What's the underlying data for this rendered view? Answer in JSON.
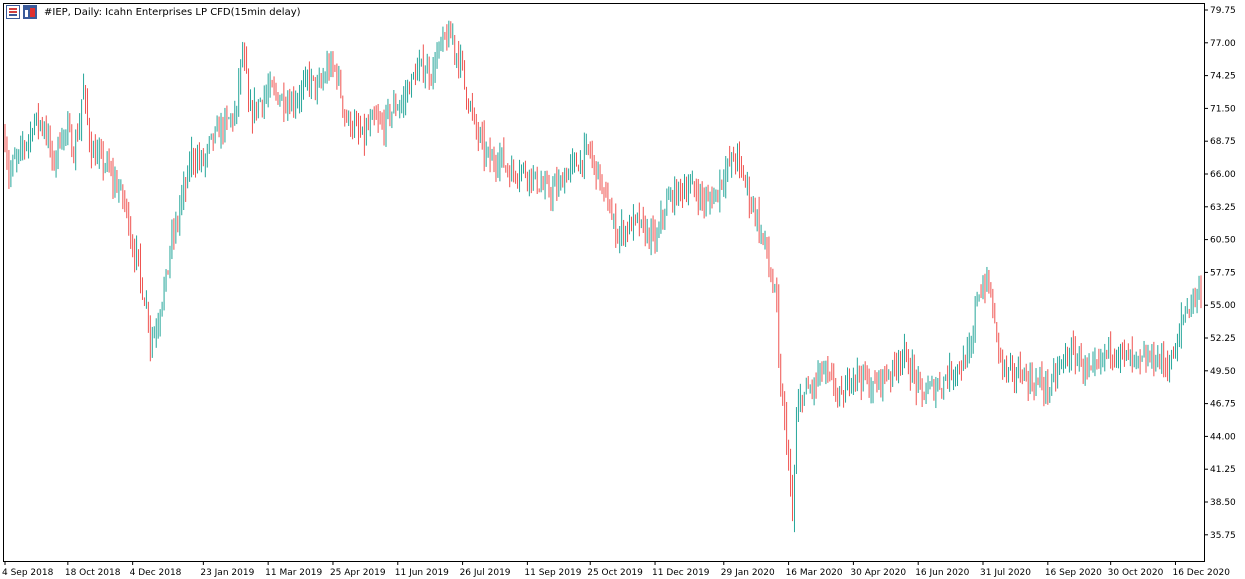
{
  "header": {
    "title": "#IEP, Daily:  Icahn Enterprises LP CFD(15min delay)",
    "icons": [
      "chart-settings-icon",
      "color-scheme-icon"
    ]
  },
  "colors": {
    "up": "#26a69a",
    "down": "#ef5350",
    "axis": "#000000",
    "background": "#ffffff"
  },
  "chart_data": {
    "type": "bar",
    "subtype": "ohlc",
    "ylim": [
      33.0,
      79.75
    ],
    "y_ticks": [
      79.75,
      77.0,
      74.25,
      71.5,
      68.75,
      66.0,
      63.25,
      60.5,
      57.75,
      55.0,
      52.25,
      49.5,
      46.75,
      44.0,
      41.25,
      38.5,
      35.75
    ],
    "y_tick_labels": [
      "79.75",
      "77.00",
      "74.25",
      "71.50",
      "68.75",
      "66.00",
      "63.25",
      "60.50",
      "57.75",
      "55.00",
      "52.25",
      "49.50",
      "46.75",
      "44.00",
      "41.25",
      "38.50",
      "35.75"
    ],
    "x_ticks": [
      "4 Sep 2018",
      "18 Oct 2018",
      "4 Dec 2018",
      "23 Jan 2019",
      "11 Mar 2019",
      "25 Apr 2019",
      "11 Jun 2019",
      "26 Jul 2019",
      "11 Sep 2019",
      "25 Oct 2019",
      "11 Dec 2019",
      "29 Jan 2020",
      "16 Mar 2020",
      "30 Apr 2020",
      "16 Jun 2020",
      "31 Jul 2020",
      "16 Sep 2020",
      "30 Oct 2020",
      "16 Dec 2020"
    ],
    "waypoints": [
      [
        "2018-09-04",
        69.0
      ],
      [
        "2018-09-06",
        66.0
      ],
      [
        "2018-09-11",
        67.0
      ],
      [
        "2018-09-18",
        68.5
      ],
      [
        "2018-09-25",
        70.5
      ],
      [
        "2018-10-02",
        70.0
      ],
      [
        "2018-10-08",
        66.5
      ],
      [
        "2018-10-12",
        69.0
      ],
      [
        "2018-10-18",
        69.5
      ],
      [
        "2018-10-23",
        68.0
      ],
      [
        "2018-10-30",
        73.0
      ],
      [
        "2018-11-02",
        69.0
      ],
      [
        "2018-11-07",
        67.5
      ],
      [
        "2018-11-13",
        67.0
      ],
      [
        "2018-11-20",
        65.5
      ],
      [
        "2018-11-27",
        64.0
      ],
      [
        "2018-12-04",
        60.0
      ],
      [
        "2018-12-10",
        57.0
      ],
      [
        "2018-12-17",
        52.0
      ],
      [
        "2018-12-24",
        55.0
      ],
      [
        "2018-12-31",
        60.0
      ],
      [
        "2019-01-08",
        64.0
      ],
      [
        "2019-01-15",
        67.5
      ],
      [
        "2019-01-23",
        67.0
      ],
      [
        "2019-01-30",
        69.0
      ],
      [
        "2019-02-06",
        70.0
      ],
      [
        "2019-02-11",
        70.5
      ],
      [
        "2019-02-15",
        71.0
      ],
      [
        "2019-02-20",
        76.0
      ],
      [
        "2019-02-25",
        71.0
      ],
      [
        "2019-03-04",
        72.0
      ],
      [
        "2019-03-11",
        73.0
      ],
      [
        "2019-03-18",
        72.5
      ],
      [
        "2019-03-25",
        72.0
      ],
      [
        "2019-04-01",
        72.5
      ],
      [
        "2019-04-08",
        74.0
      ],
      [
        "2019-04-15",
        73.0
      ],
      [
        "2019-04-22",
        75.0
      ],
      [
        "2019-04-29",
        74.5
      ],
      [
        "2019-05-03",
        71.0
      ],
      [
        "2019-05-10",
        70.0
      ],
      [
        "2019-05-17",
        69.0
      ],
      [
        "2019-05-24",
        70.5
      ],
      [
        "2019-05-31",
        70.0
      ],
      [
        "2019-06-07",
        71.5
      ],
      [
        "2019-06-14",
        72.0
      ],
      [
        "2019-06-21",
        74.0
      ],
      [
        "2019-06-28",
        75.0
      ],
      [
        "2019-07-05",
        74.5
      ],
      [
        "2019-07-12",
        77.0
      ],
      [
        "2019-07-19",
        77.5
      ],
      [
        "2019-07-26",
        75.0
      ],
      [
        "2019-08-02",
        71.0
      ],
      [
        "2019-08-09",
        68.5
      ],
      [
        "2019-08-16",
        67.0
      ],
      [
        "2019-08-23",
        67.5
      ],
      [
        "2019-08-30",
        66.0
      ],
      [
        "2019-09-06",
        66.5
      ],
      [
        "2019-09-13",
        66.0
      ],
      [
        "2019-09-20",
        65.0
      ],
      [
        "2019-09-27",
        64.5
      ],
      [
        "2019-10-04",
        65.0
      ],
      [
        "2019-10-11",
        66.5
      ],
      [
        "2019-10-18",
        67.0
      ],
      [
        "2019-10-25",
        68.0
      ],
      [
        "2019-10-31",
        66.0
      ],
      [
        "2019-11-07",
        63.5
      ],
      [
        "2019-11-14",
        61.0
      ],
      [
        "2019-11-21",
        61.5
      ],
      [
        "2019-11-28",
        62.0
      ],
      [
        "2019-12-05",
        61.0
      ],
      [
        "2019-12-12",
        60.5
      ],
      [
        "2019-12-19",
        63.5
      ],
      [
        "2019-12-27",
        64.5
      ],
      [
        "2020-01-03",
        65.0
      ],
      [
        "2020-01-10",
        64.5
      ],
      [
        "2020-01-17",
        63.5
      ],
      [
        "2020-01-24",
        64.5
      ],
      [
        "2020-01-31",
        66.5
      ],
      [
        "2020-02-07",
        67.5
      ],
      [
        "2020-02-14",
        65.0
      ],
      [
        "2020-02-21",
        62.5
      ],
      [
        "2020-02-26",
        60.5
      ],
      [
        "2020-03-02",
        58.0
      ],
      [
        "2020-03-06",
        55.0
      ],
      [
        "2020-03-10",
        48.0
      ],
      [
        "2020-03-13",
        44.0
      ],
      [
        "2020-03-16",
        41.5
      ],
      [
        "2020-03-18",
        37.0
      ],
      [
        "2020-03-20",
        45.0
      ],
      [
        "2020-03-25",
        47.5
      ],
      [
        "2020-04-01",
        48.0
      ],
      [
        "2020-04-08",
        49.5
      ],
      [
        "2020-04-15",
        48.5
      ],
      [
        "2020-04-22",
        47.0
      ],
      [
        "2020-04-30",
        49.5
      ],
      [
        "2020-05-07",
        49.0
      ],
      [
        "2020-05-14",
        48.0
      ],
      [
        "2020-05-21",
        49.0
      ],
      [
        "2020-05-28",
        49.5
      ],
      [
        "2020-06-04",
        51.0
      ],
      [
        "2020-06-11",
        49.5
      ],
      [
        "2020-06-18",
        47.5
      ],
      [
        "2020-06-25",
        48.0
      ],
      [
        "2020-07-02",
        48.5
      ],
      [
        "2020-07-09",
        49.5
      ],
      [
        "2020-07-16",
        50.0
      ],
      [
        "2020-07-23",
        51.0
      ],
      [
        "2020-07-28",
        56.0
      ],
      [
        "2020-08-04",
        57.0
      ],
      [
        "2020-08-10",
        53.0
      ],
      [
        "2020-08-14",
        50.0
      ],
      [
        "2020-08-21",
        49.0
      ],
      [
        "2020-08-28",
        49.5
      ],
      [
        "2020-09-04",
        48.5
      ],
      [
        "2020-09-11",
        48.5
      ],
      [
        "2020-09-18",
        48.0
      ],
      [
        "2020-09-25",
        50.0
      ],
      [
        "2020-10-02",
        51.0
      ],
      [
        "2020-10-09",
        50.5
      ],
      [
        "2020-10-16",
        49.0
      ],
      [
        "2020-10-23",
        50.0
      ],
      [
        "2020-10-30",
        51.5
      ],
      [
        "2020-11-06",
        51.0
      ],
      [
        "2020-11-13",
        50.5
      ],
      [
        "2020-11-20",
        50.0
      ],
      [
        "2020-11-27",
        50.5
      ],
      [
        "2020-12-04",
        50.5
      ],
      [
        "2020-12-11",
        50.0
      ],
      [
        "2020-12-16",
        51.0
      ],
      [
        "2020-12-21",
        54.0
      ],
      [
        "2020-12-28",
        55.5
      ],
      [
        "2021-01-04",
        56.5
      ]
    ]
  }
}
